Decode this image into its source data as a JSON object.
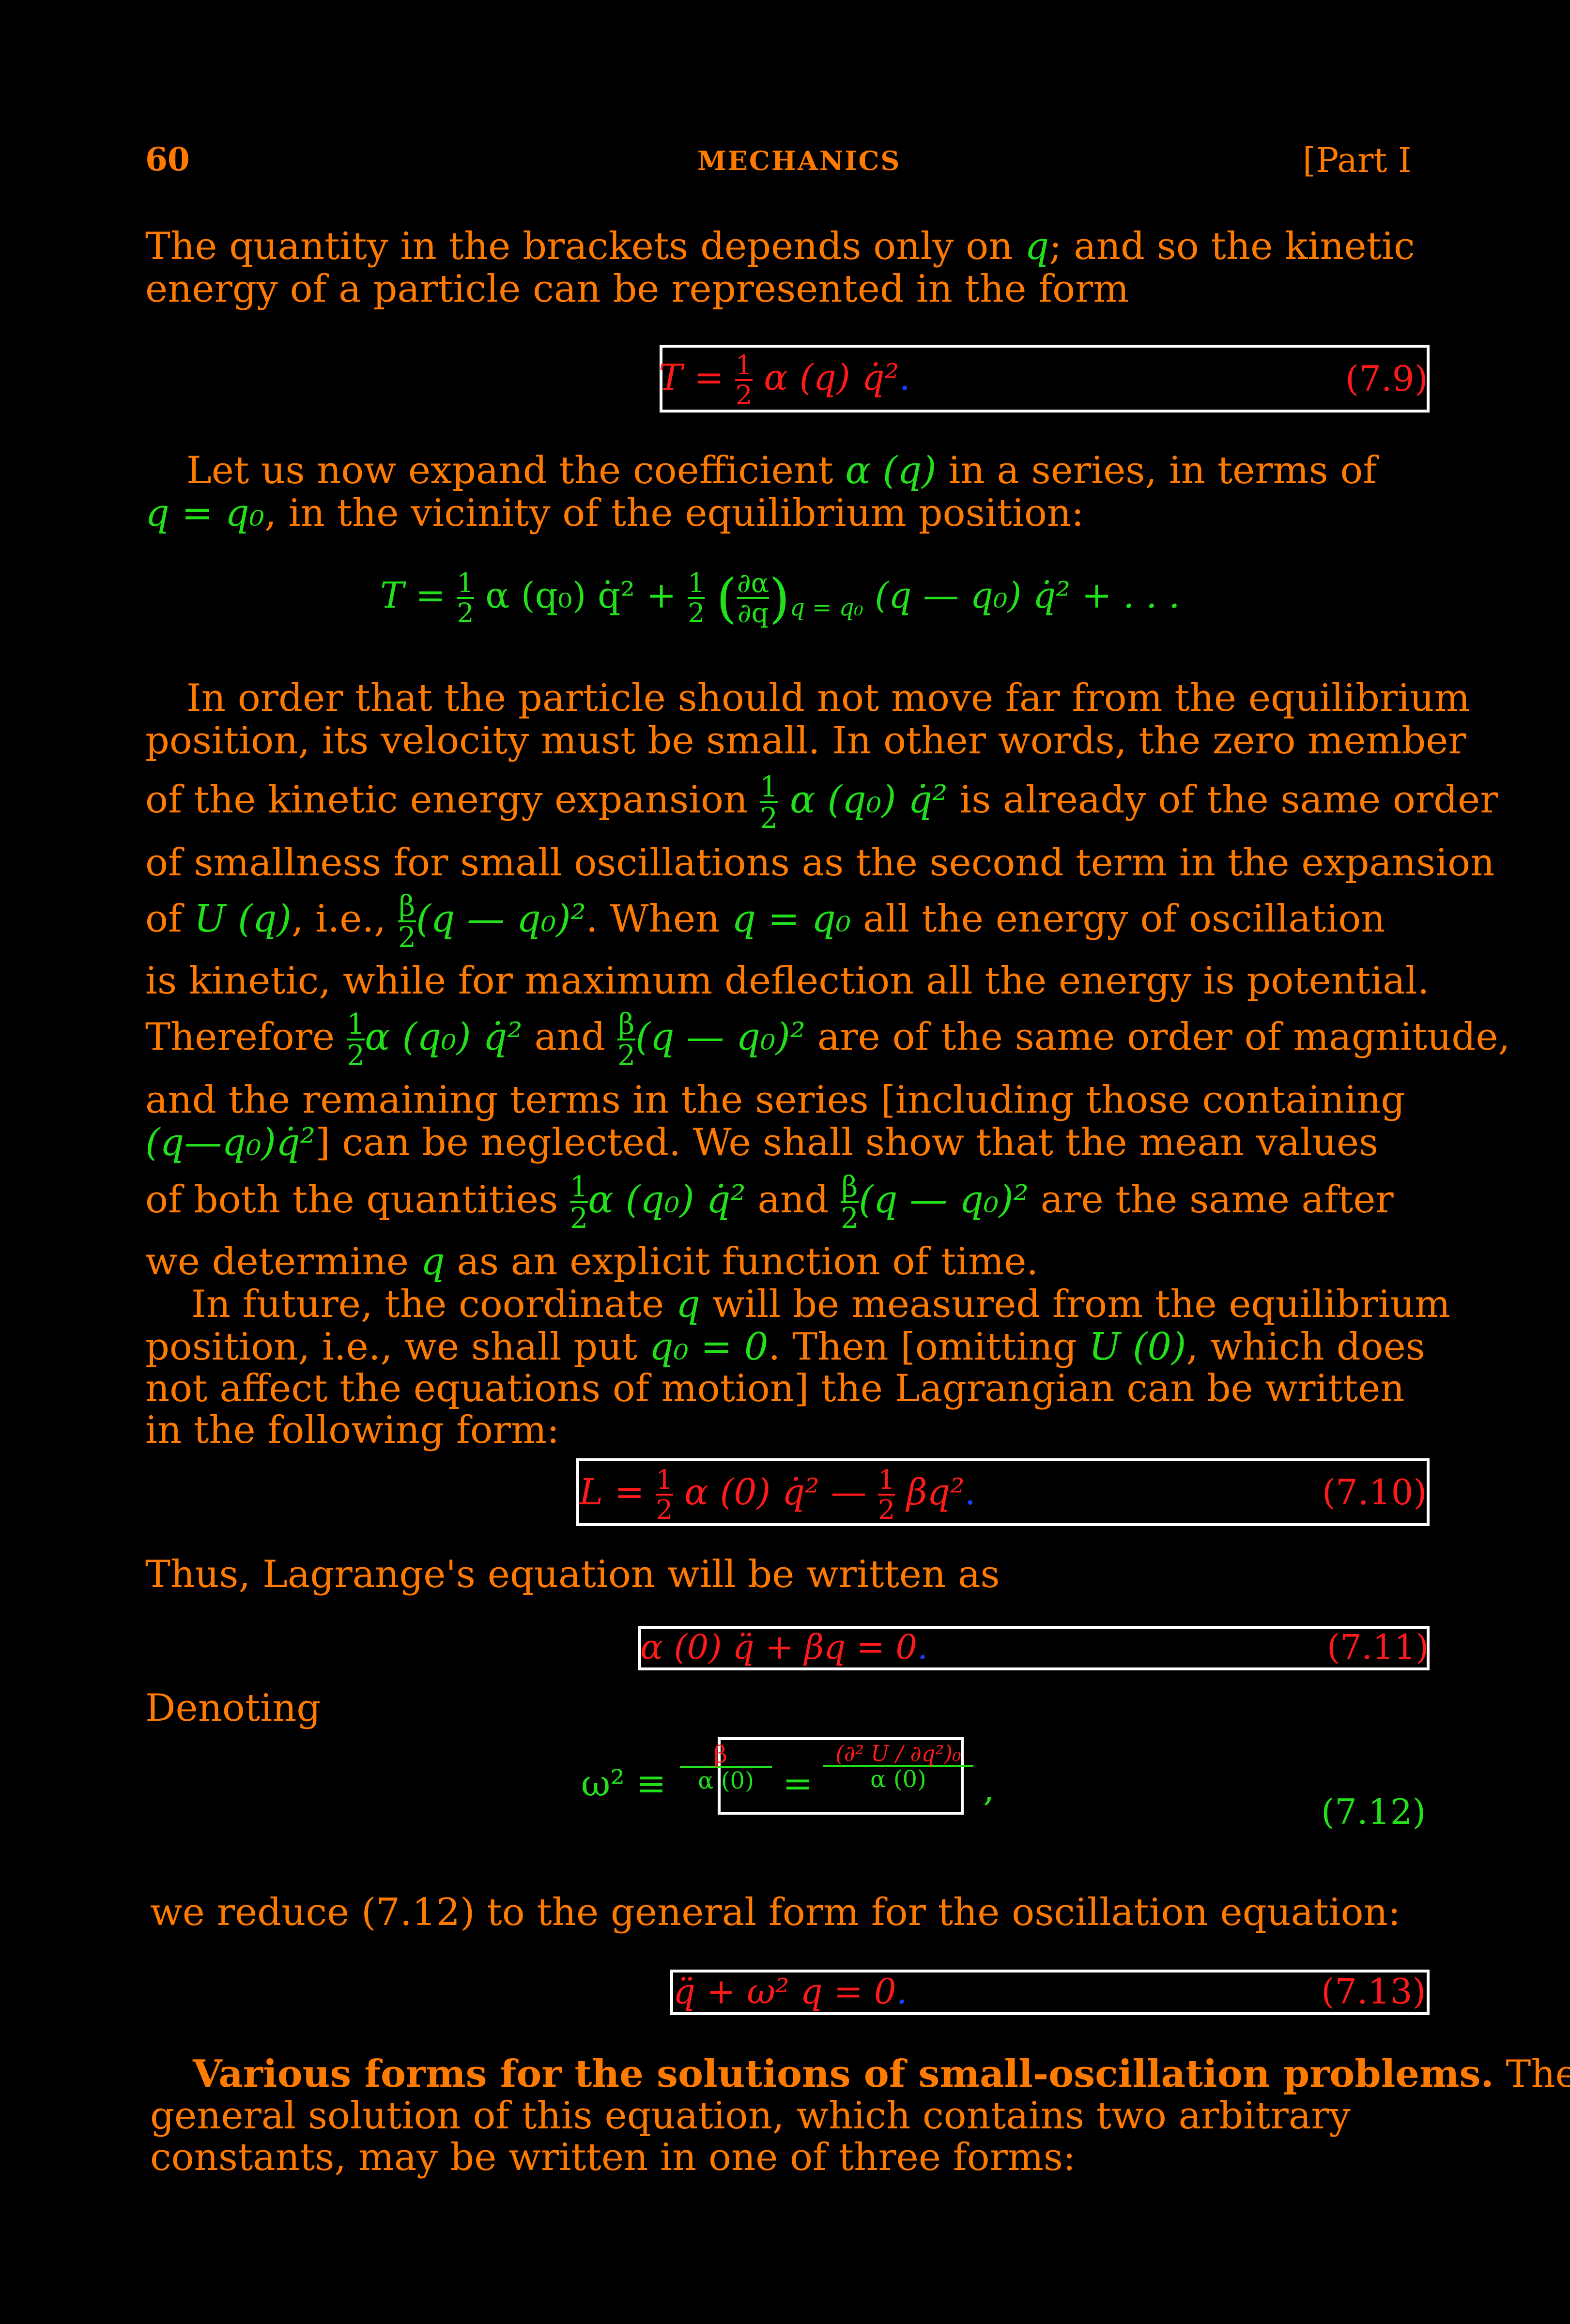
{
  "header": {
    "page_number": "60",
    "running_title": "MECHANICS",
    "part": "[Part I"
  },
  "para1": {
    "line1_a": "The quantity in the brackets depends only on ",
    "line1_q": "q",
    "line1_b": "; and so the kinetic",
    "line2": "energy of a particle can be represented in the form"
  },
  "eq_7_9": {
    "lhs": "T",
    "eq": "=",
    "num": "1",
    "den": "2",
    "rhs": "α (q) q̇²",
    "dot": ".",
    "label": "(7.9)"
  },
  "para2": {
    "line1": "Let us now expand the coefficient ",
    "line1_math": "α (q)",
    "line1_end": " in a series, in terms of",
    "line2_math": "q = q₀",
    "line2_end": ", in the vicinity of the equilibrium position:"
  },
  "eq_expansion": {
    "t1": "T =",
    "f1_num": "1",
    "f1_den": "2",
    "t2": "α (q₀) q̇² +",
    "f2_num": "1",
    "f2_den": "2",
    "paren_num": "∂α",
    "paren_den": "∂q",
    "subscript": "q = q₀",
    "t3": "(q — q₀) q̇² + . . ."
  },
  "para3": {
    "l1": "In order that the particle should not move far from the equilibrium",
    "l2": "position, its velocity must be small. In other words, the zero member",
    "l3_a": "of the kinetic energy expansion ",
    "l3_num": "1",
    "l3_den": "2",
    "l3_math": "α (q₀) q̇²",
    "l3_b": " is already of the same order",
    "l4": "of smallness for small oscillations as the second term in the expansion",
    "l5_a": "of ",
    "l5_math1": "U (q)",
    "l5_b": ", i.e., ",
    "l5_num": "β",
    "l5_den": "2",
    "l5_math2": "(q — q₀)²",
    "l5_c": ". When ",
    "l5_math3": "q = q₀",
    "l5_d": " all the energy of oscillation",
    "l6": "is kinetic, while for maximum deflection all the energy is potential.",
    "l7_a": "Therefore ",
    "l7_num1": "1",
    "l7_den1": "2",
    "l7_math1": "α (q₀) q̇²",
    "l7_b": " and ",
    "l7_num2": "β",
    "l7_den2": "2",
    "l7_math2": "(q — q₀)²",
    "l7_c": " are of the same order of magnitude,",
    "l8": "and the remaining terms in the series [including those containing",
    "l9_math": "(q—q₀)q̇²",
    "l9_b": "] can be neglected. We shall show that the mean values",
    "l10_a": "of both the quantities ",
    "l10_num1": "1",
    "l10_den1": "2",
    "l10_math1": "α (q₀) q̇²",
    "l10_b": " and ",
    "l10_num2": "β",
    "l10_den2": "2",
    "l10_math2": "(q — q₀)²",
    "l10_c": " are the same after",
    "l11_a": "we determine ",
    "l11_math": "q",
    "l11_b": " as an explicit function of time."
  },
  "para4": {
    "l1_a": "In future, the coordinate ",
    "l1_math": "q",
    "l1_b": " will be measured from the equilibrium",
    "l2_a": "position, i.e., we shall put ",
    "l2_math": "q₀ = 0",
    "l2_b": ". Then [omitting ",
    "l2_math2": "U (0)",
    "l2_c": ", which does",
    "l3": "not affect the equations of motion] the Lagrangian can be written",
    "l4": "in the following form:"
  },
  "eq_7_10": {
    "lhs": "L =",
    "f1_num": "1",
    "f1_den": "2",
    "m1": "α (0) q̇² —",
    "f2_num": "1",
    "f2_den": "2",
    "m2": "βq²",
    "dot": ".",
    "label": "(7.10)"
  },
  "para5": {
    "text": "Thus, Lagrange's equation will be written as"
  },
  "eq_7_11": {
    "expr": "α (0) q̈ + βq = 0",
    "dot": ".",
    "label": "(7.11)"
  },
  "para6": {
    "text": "Denoting"
  },
  "eq_7_12": {
    "lhs": "ω² ≡",
    "f1_num": "β",
    "f1_den": "α (0)",
    "eq": "=",
    "f2_num": "(∂² U / ∂q²)₀",
    "f2_den": "α (0)",
    "comma": ",",
    "label": "(7.12)"
  },
  "para7": {
    "text": "we reduce (7.12) to the general form for the oscillation equation:"
  },
  "eq_7_13": {
    "expr": "q̈ + ω² q = 0",
    "dot": ".",
    "label": "(7.13)"
  },
  "para8": {
    "bold": "Various forms for the solutions of small-oscillation problems.",
    "l1_rest": " The",
    "l2": "general solution of this equation, which contains two arbitrary",
    "l3": "constants, may be written in one of three forms:"
  },
  "colors": {
    "text": "#ff7a00",
    "math": "#22e01a",
    "boxed_eq": "#ff1a1a",
    "box_border": "#ffffff",
    "background": "#000000"
  }
}
